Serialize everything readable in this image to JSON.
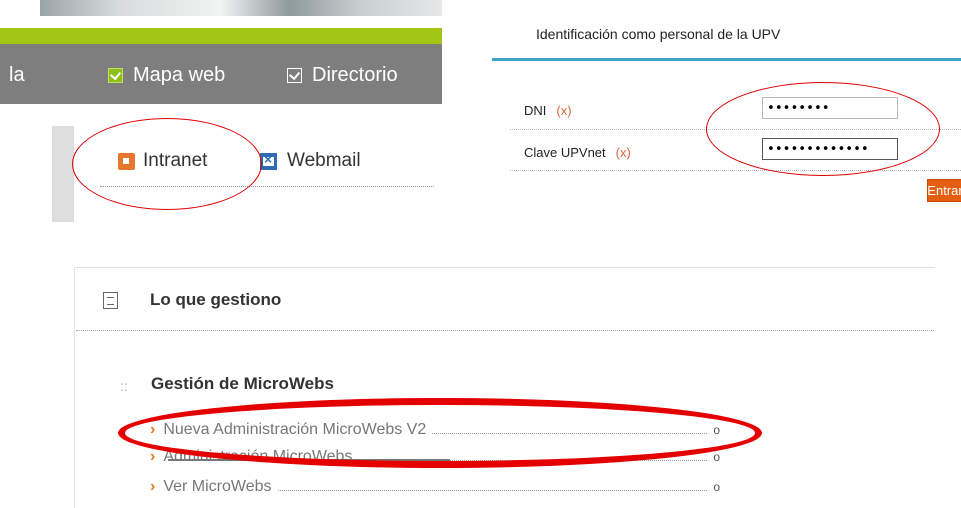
{
  "header": {
    "cut_label": "la",
    "nav_links": [
      {
        "label": "Mapa web"
      },
      {
        "label": "Directorio"
      }
    ]
  },
  "quick_links": {
    "intranet": "Intranet",
    "webmail": "Webmail"
  },
  "login": {
    "title": "Identificación como personal de la UPV",
    "dni_label": "DNI",
    "dni_required": "(x)",
    "dni_value": "••••••••",
    "clave_label": "Clave UPVnet",
    "clave_required": "(x)",
    "clave_value": "•••••••••••••",
    "submit_label": "Entrar"
  },
  "panel": {
    "title": "Lo que gestiono",
    "group_bullet": "::",
    "group_title": "Gestión de MicroWebs",
    "items": [
      {
        "label": "Nueva Administración MicroWebs V2",
        "end": "o"
      },
      {
        "label": "Administración MicroWebs",
        "end": "o"
      },
      {
        "label": "Ver MicroWebs",
        "end": "o"
      }
    ]
  },
  "colors": {
    "accent_green": "#a2c614",
    "nav_gray": "#7e7e7e",
    "login_rule": "#3fa3c6",
    "button_orange": "#e45e12",
    "annotation_red": "#e40000"
  }
}
